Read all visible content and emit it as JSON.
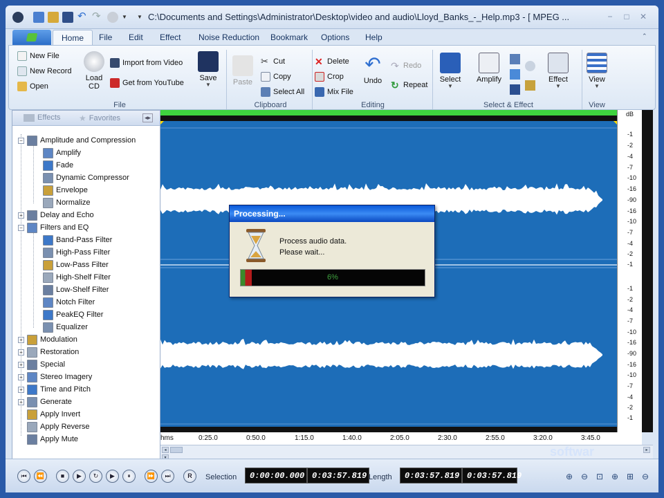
{
  "window": {
    "title": "C:\\Documents and Settings\\Administrator\\Desktop\\video and audio\\Lloyd_Banks_-_Help.mp3 - [ MPEG ..."
  },
  "tabs": [
    {
      "label": "Home",
      "active": true
    },
    {
      "label": "File"
    },
    {
      "label": "Edit"
    },
    {
      "label": "Effect"
    },
    {
      "label": "Noise Reduction"
    },
    {
      "label": "Bookmark"
    },
    {
      "label": "Options"
    },
    {
      "label": "Help"
    }
  ],
  "ribbon": {
    "file": {
      "new_file": "New File",
      "new_record": "New Record",
      "open": "Open",
      "load_cd_1": "Load",
      "load_cd_2": "CD",
      "import_video": "Import from Video",
      "get_youtube": "Get from YouTube",
      "save": "Save",
      "group": "File"
    },
    "clipboard": {
      "paste": "Paste",
      "cut": "Cut",
      "copy": "Copy",
      "select_all": "Select All",
      "group": "Clipboard"
    },
    "editing": {
      "delete": "Delete",
      "crop": "Crop",
      "mix_file": "Mix File",
      "undo": "Undo",
      "redo": "Redo",
      "repeat": "Repeat",
      "group": "Editing"
    },
    "select_effect": {
      "select": "Select",
      "amplify": "Amplify",
      "effect": "Effect",
      "group": "Select & Effect"
    },
    "view": {
      "view": "View",
      "group": "View"
    }
  },
  "sidebar": {
    "tab_effects": "Effects",
    "tab_favorites": "Favorites",
    "tree": [
      {
        "label": "Amplitude and Compression",
        "level": 0,
        "expander": "−"
      },
      {
        "label": "Amplify",
        "level": 1
      },
      {
        "label": "Fade",
        "level": 1
      },
      {
        "label": "Dynamic Compressor",
        "level": 1
      },
      {
        "label": "Envelope",
        "level": 1
      },
      {
        "label": "Normalize",
        "level": 1
      },
      {
        "label": "Delay and Echo",
        "level": 0,
        "expander": "+"
      },
      {
        "label": "Filters and EQ",
        "level": 0,
        "expander": "−"
      },
      {
        "label": "Band-Pass Filter",
        "level": 1
      },
      {
        "label": "High-Pass Filter",
        "level": 1
      },
      {
        "label": "Low-Pass Filter",
        "level": 1
      },
      {
        "label": "High-Shelf Filter",
        "level": 1
      },
      {
        "label": "Low-Shelf Filter",
        "level": 1
      },
      {
        "label": "Notch Filter",
        "level": 1
      },
      {
        "label": "PeakEQ Filter",
        "level": 1
      },
      {
        "label": "Equalizer",
        "level": 1
      },
      {
        "label": "Modulation",
        "level": 0,
        "expander": "+"
      },
      {
        "label": "Restoration",
        "level": 0,
        "expander": "+"
      },
      {
        "label": "Special",
        "level": 0,
        "expander": "+"
      },
      {
        "label": "Stereo Imagery",
        "level": 0,
        "expander": "+"
      },
      {
        "label": "Time and Pitch",
        "level": 0,
        "expander": "+"
      },
      {
        "label": "Generate",
        "level": 0,
        "expander": "+"
      },
      {
        "label": "Apply Invert",
        "level": 0
      },
      {
        "label": "Apply Reverse",
        "level": 0
      },
      {
        "label": "Apply Mute",
        "level": 0
      }
    ]
  },
  "db_scale": {
    "unit": "dB",
    "ticks_top": [
      "-1",
      "-2",
      "-4",
      "-7",
      "-10",
      "-16",
      "-90",
      "-16",
      "-10",
      "-7",
      "-4",
      "-2",
      "-1"
    ],
    "ticks_bottom": [
      "-1",
      "-2",
      "-4",
      "-7",
      "-10",
      "-16",
      "-90",
      "-16",
      "-10",
      "-7",
      "-4",
      "-2",
      "-1"
    ]
  },
  "time_ruler": [
    "hms",
    "0:25.0",
    "0:50.0",
    "1:15.0",
    "1:40.0",
    "2:05.0",
    "2:30.0",
    "2:55.0",
    "3:20.0",
    "3:45.0"
  ],
  "dialog": {
    "title": "Processing...",
    "line1": "Process audio data.",
    "line2": "Please wait...",
    "progress_percent": 6,
    "progress_label": "6%"
  },
  "transport": {
    "selection_label": "Selection",
    "selection_start": "0:00:00.000",
    "selection_end": "0:03:57.819",
    "length_label": "Length",
    "length_value": "0:03:57.819",
    "total_value": "0:03:57.819",
    "r_button": "R"
  },
  "watermark": "softwar"
}
